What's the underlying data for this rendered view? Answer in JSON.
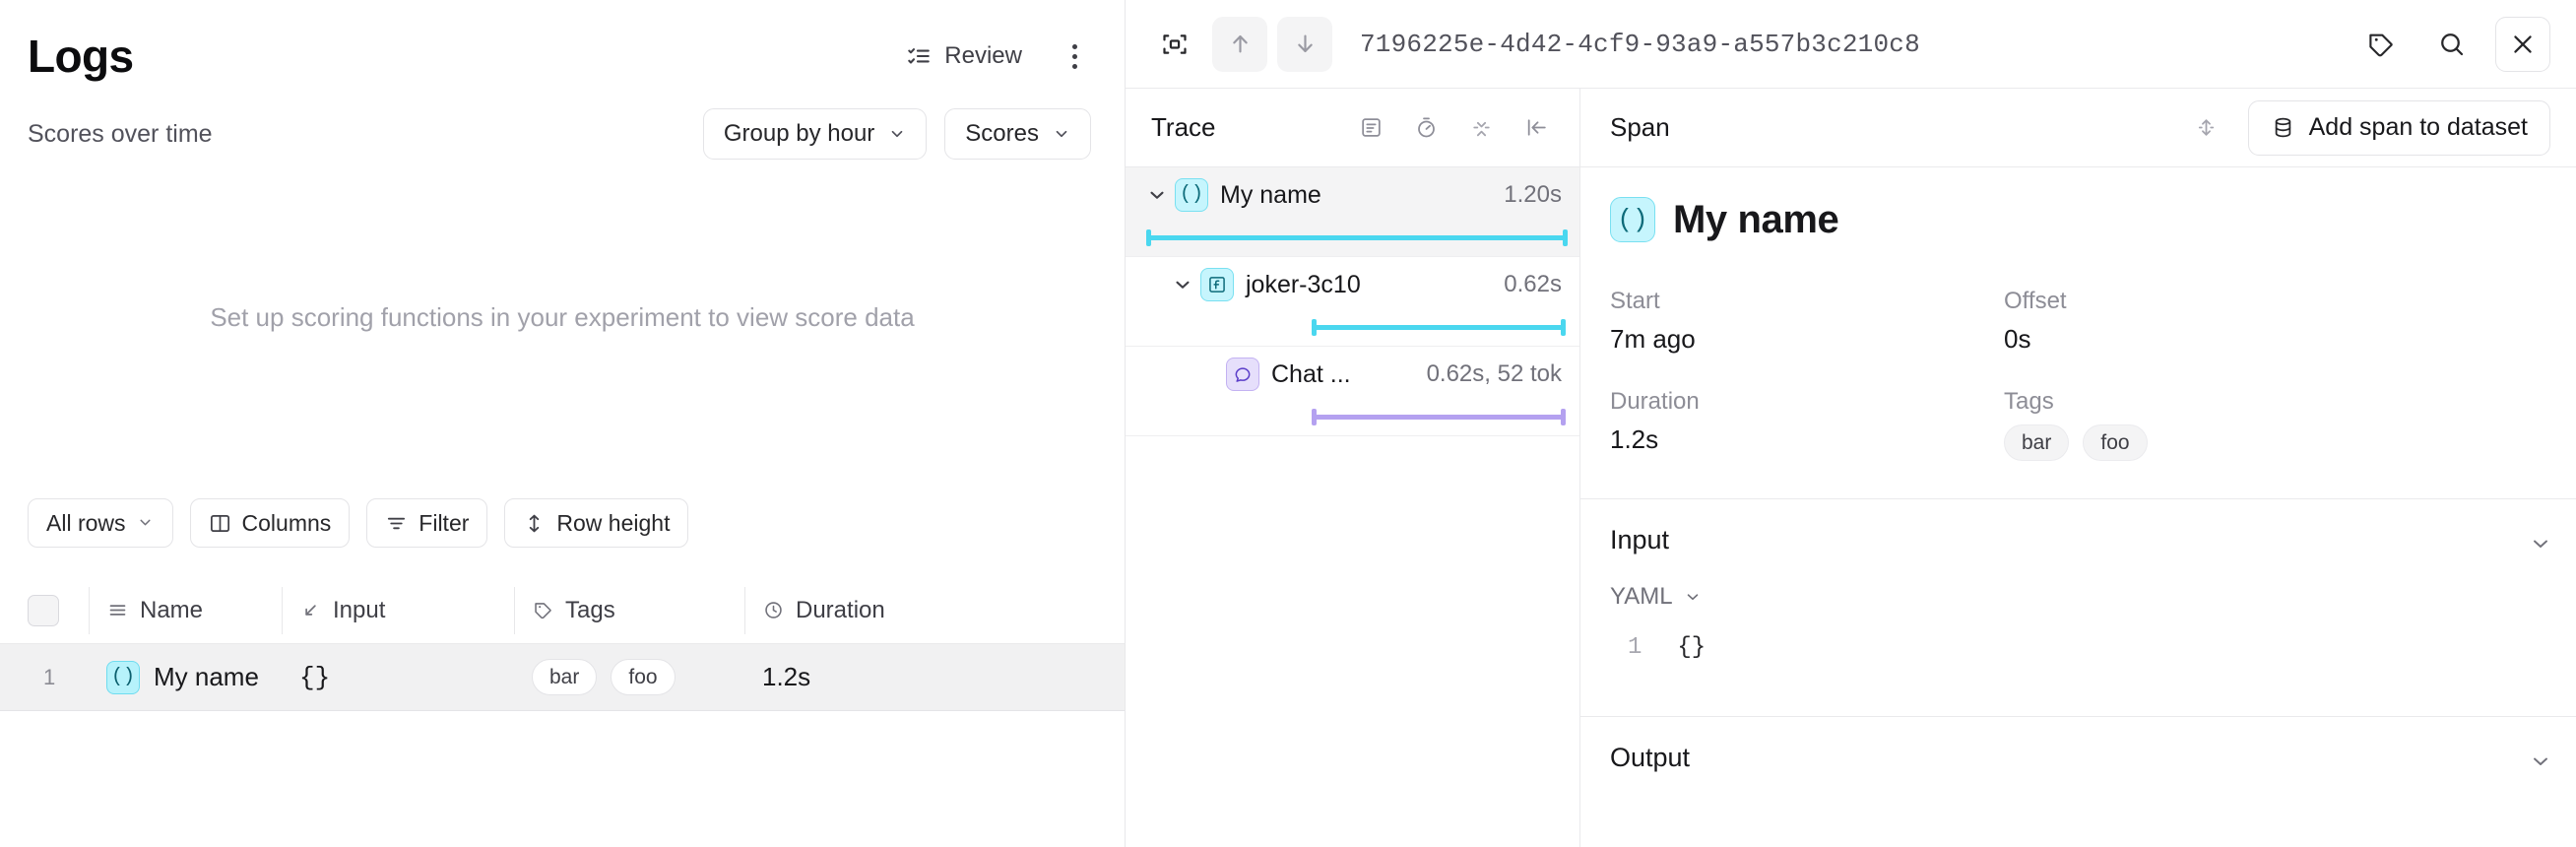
{
  "left": {
    "title": "Logs",
    "review_label": "Review",
    "review_icon": "checklist-icon",
    "kebab_icon": "more-vertical-icon",
    "chart": {
      "label": "Scores over time",
      "group_by_label": "Group by hour",
      "scores_label": "Scores",
      "empty_message": "Set up scoring functions in your experiment to view score data"
    },
    "toolbar": [
      {
        "label": "All rows",
        "icon": "chevron-down-icon",
        "chevron": true
      },
      {
        "label": "Columns",
        "icon": "columns-icon",
        "chevron": false
      },
      {
        "label": "Filter",
        "icon": "filter-icon",
        "chevron": false
      },
      {
        "label": "Row height",
        "icon": "row-height-icon",
        "chevron": false
      }
    ],
    "table": {
      "columns": [
        {
          "label": "Name",
          "icon": "menu-lines-icon"
        },
        {
          "label": "Input",
          "icon": "arrow-down-right-icon"
        },
        {
          "label": "Tags",
          "icon": "tag-icon"
        },
        {
          "label": "Duration",
          "icon": "clock-icon"
        }
      ],
      "rows": [
        {
          "number": "1",
          "badge": "()",
          "name": "My name",
          "input": "{}",
          "tags": [
            "bar",
            "foo"
          ],
          "duration": "1.2s"
        }
      ]
    }
  },
  "right": {
    "topbar": {
      "expand_icon": "expand-span-icon",
      "up_icon": "arrow-up-icon",
      "down_icon": "arrow-down-icon",
      "trace_id": "7196225e-4d42-4cf9-93a9-a557b3c210c8",
      "tag_icon": "tag-icon",
      "search_icon": "search-icon",
      "close_icon": "close-icon"
    },
    "trace": {
      "title": "Trace",
      "icons": [
        "summary-icon",
        "timer-icon",
        "collapse-all-icon",
        "collapse-panel-icon"
      ],
      "spans": [
        {
          "name": "My name",
          "badge": "()",
          "badge_style": "cyan",
          "duration": "1.20s",
          "caret": true,
          "selected": true,
          "indent": 0,
          "bar_start_pct": 4,
          "bar_width_pct": 93,
          "bar_color": "#4ad7ef"
        },
        {
          "name": "joker-3c10",
          "badge": "ƒ",
          "badge_style": "cyan",
          "duration": "0.62s",
          "caret": true,
          "selected": false,
          "indent": 1,
          "bar_start_pct": 41,
          "bar_width_pct": 56,
          "bar_color": "#4ad7ef"
        },
        {
          "name": "Chat ...",
          "badge": "◯",
          "badge_style": "purple",
          "duration": "0.62s, 52 tok",
          "caret": false,
          "selected": false,
          "indent": 2,
          "bar_start_pct": 41,
          "bar_width_pct": 56,
          "bar_color": "#b4a1f0"
        }
      ]
    },
    "span": {
      "pane_title": "Span",
      "resize_icon": "resize-vertical-icon",
      "add_to_dataset_label": "Add span to dataset",
      "add_to_dataset_icon": "database-icon",
      "badge": "()",
      "name": "My name",
      "meta": [
        {
          "label": "Start",
          "value": "7m ago"
        },
        {
          "label": "Offset",
          "value": "0s"
        },
        {
          "label": "Duration",
          "value": "1.2s"
        }
      ],
      "tags_label": "Tags",
      "tags": [
        "bar",
        "foo"
      ],
      "input": {
        "title": "Input",
        "format_label": "YAML",
        "line_number": "1",
        "line_text": "{}"
      },
      "output": {
        "title": "Output"
      }
    }
  },
  "colors": {
    "accent_cyan": "#4ad7ef",
    "accent_purple": "#b4a1f0",
    "row_selected": "#f1f1f2",
    "border": "#e4e4e7",
    "muted_text": "#71717a"
  }
}
